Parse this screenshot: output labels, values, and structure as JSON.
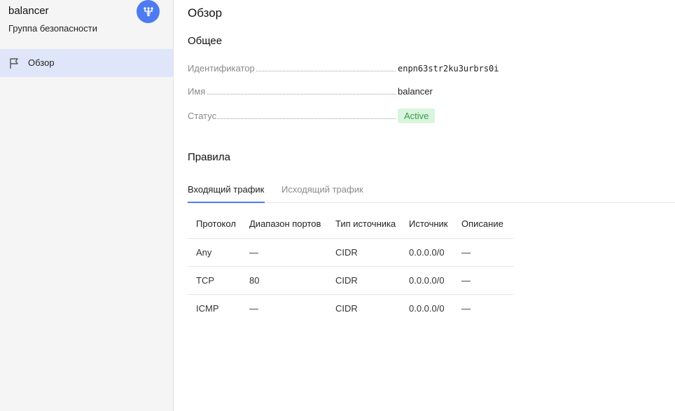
{
  "sidebar": {
    "title": "balancer",
    "subtitle": "Группа безопасности",
    "nav_label": "Обзор"
  },
  "main": {
    "page_title": "Обзор",
    "general_heading": "Общее",
    "fields": {
      "id_label": "Идентификатор",
      "id_value": "enpn63str2ku3urbrs0i",
      "name_label": "Имя",
      "name_value": "balancer",
      "status_label": "Статус",
      "status_value": "Active"
    },
    "rules_heading": "Правила",
    "tabs": {
      "ingress": "Входящий трафик",
      "egress": "Исходящий трафик"
    },
    "table": {
      "headers": [
        "Протокол",
        "Диапазон портов",
        "Тип источника",
        "Источник",
        "Описание"
      ],
      "rows": [
        [
          "Any",
          "—",
          "CIDR",
          "0.0.0.0/0",
          "—"
        ],
        [
          "TCP",
          "80",
          "CIDR",
          "0.0.0.0/0",
          "—"
        ],
        [
          "ICMP",
          "—",
          "CIDR",
          "0.0.0.0/0",
          "—"
        ]
      ]
    }
  },
  "colors": {
    "accent": "#4e7cf0",
    "active_nav_bg": "#dfe6f9",
    "status_bg": "#d9f5dd",
    "status_text": "#3a9a46"
  },
  "icons": {
    "avatar": "network-icon",
    "nav": "flag-icon"
  }
}
